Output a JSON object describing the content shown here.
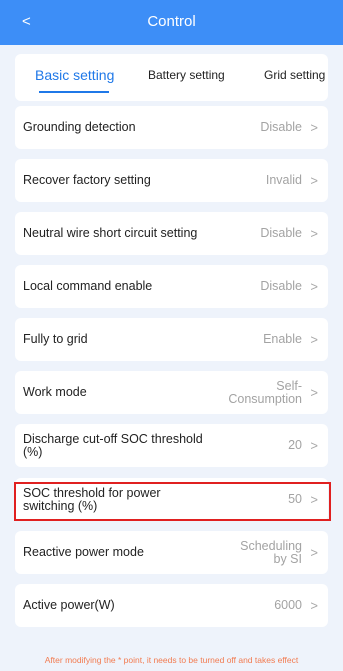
{
  "header": {
    "back_icon": "chevron-left-icon",
    "back_glyph": "<",
    "title": "Control"
  },
  "tabs": [
    {
      "label": "Basic setting",
      "active": true
    },
    {
      "label": "Battery setting",
      "active": false
    },
    {
      "label": "Grid setting",
      "active": false
    }
  ],
  "settings": [
    {
      "label": "Grounding detection",
      "value": "Disable"
    },
    {
      "label": "Recover factory setting",
      "value": "Invalid"
    },
    {
      "label": "Neutral wire short circuit setting",
      "value": "Disable"
    },
    {
      "label": "Local command enable",
      "value": "Disable"
    },
    {
      "label": "Fully to grid",
      "value": "Enable"
    },
    {
      "label": "Work mode",
      "value": "Self-Consumption"
    },
    {
      "label": "Discharge cut-off SOC threshold (%)",
      "value": "20"
    },
    {
      "label": "SOC threshold for power switching (%)",
      "value": "50",
      "highlighted": true
    },
    {
      "label": "Reactive power mode",
      "value": "Scheduling by SI"
    },
    {
      "label": "Active power(W)",
      "value": "6000"
    }
  ],
  "chevron_glyph": ">",
  "footer_note": "After modifying the * point, it needs to be turned off and takes effect",
  "colors": {
    "accent": "#3d8ef7",
    "active_tab": "#1f78e8",
    "highlight_border": "#e02020",
    "note": "#f27b50"
  }
}
